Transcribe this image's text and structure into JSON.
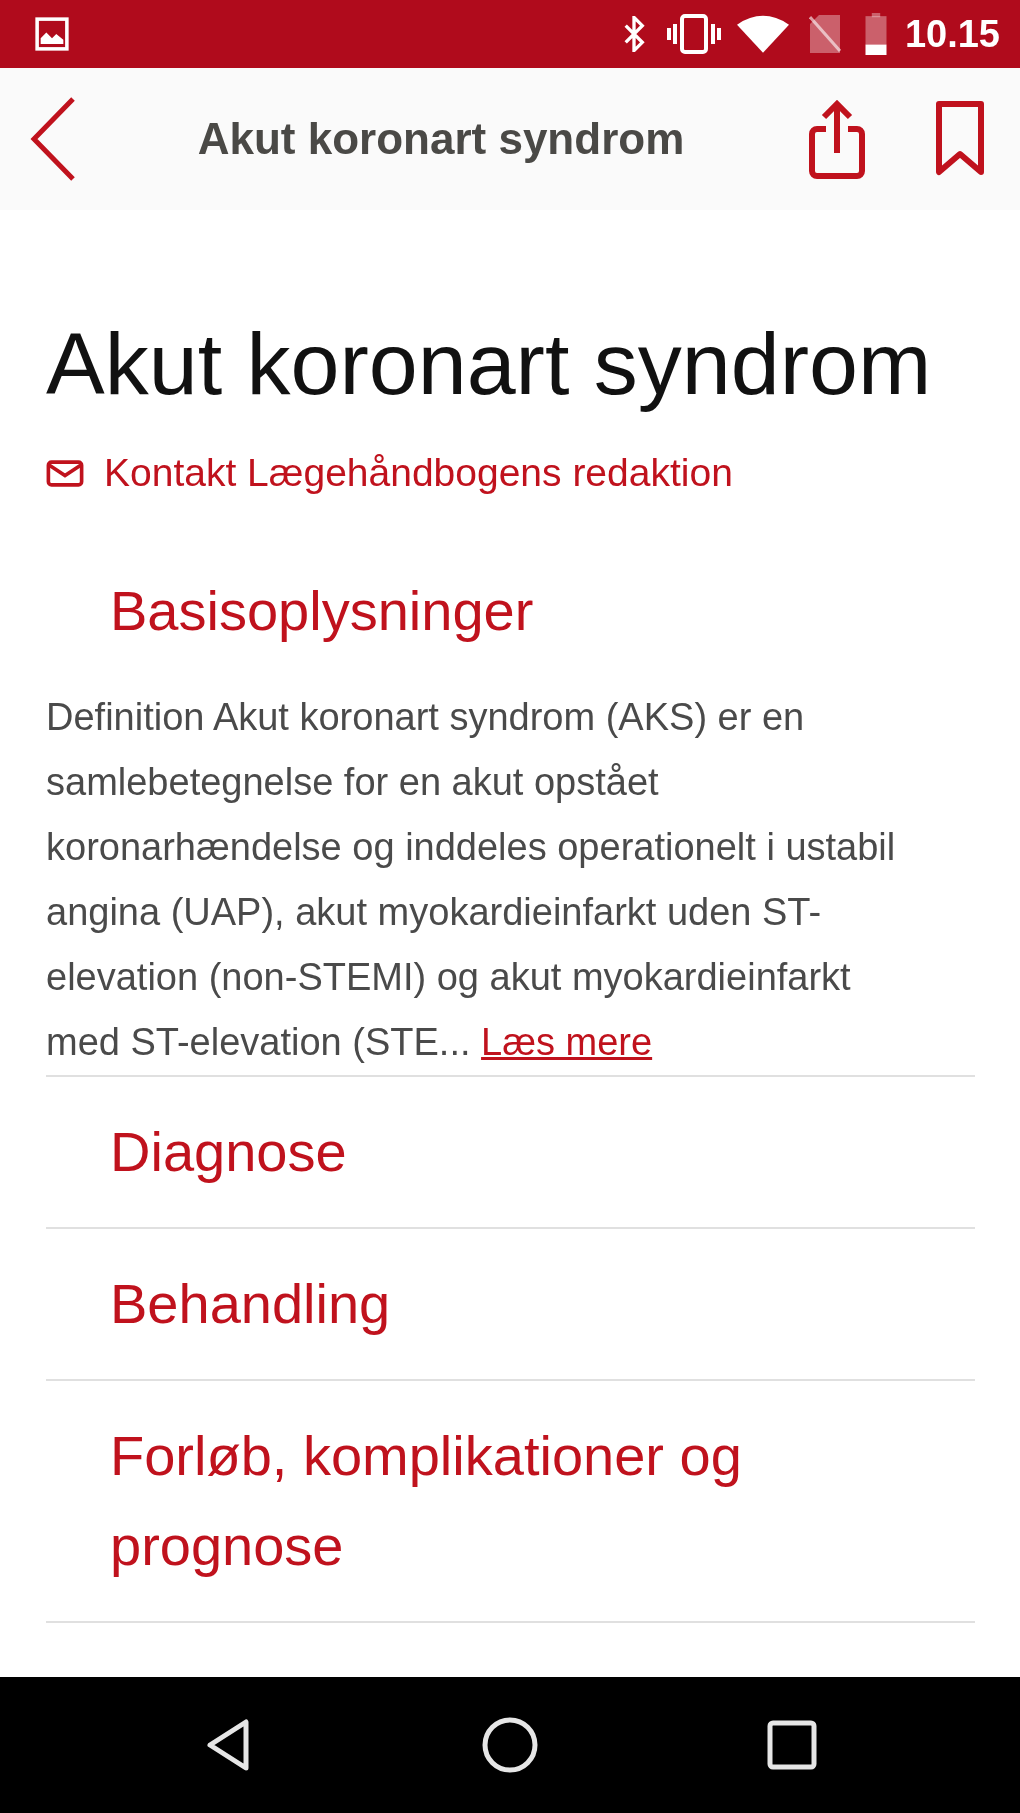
{
  "status_bar": {
    "time": "10.15"
  },
  "header": {
    "title": "Akut koronart syndrom"
  },
  "article": {
    "title": "Akut koronart syndrom",
    "contact_link": "Kontakt Lægehåndbogens redaktion",
    "sections": [
      {
        "title": "Basisoplysninger",
        "summary": "Definition Akut koronart syndrom (AKS) er en samlebetegnelse for en akut opstået koronarhændelse og inddeles operationelt i ustabil angina (UAP), akut myokardieinfarkt uden ST-elevation (non-STEMI) og akut myokardieinfarkt med ST-elevation (STE...",
        "read_more": "Læs mere"
      },
      {
        "title": "Diagnose"
      },
      {
        "title": "Behandling"
      },
      {
        "title": "Forløb, komplikationer og prognose"
      }
    ]
  }
}
